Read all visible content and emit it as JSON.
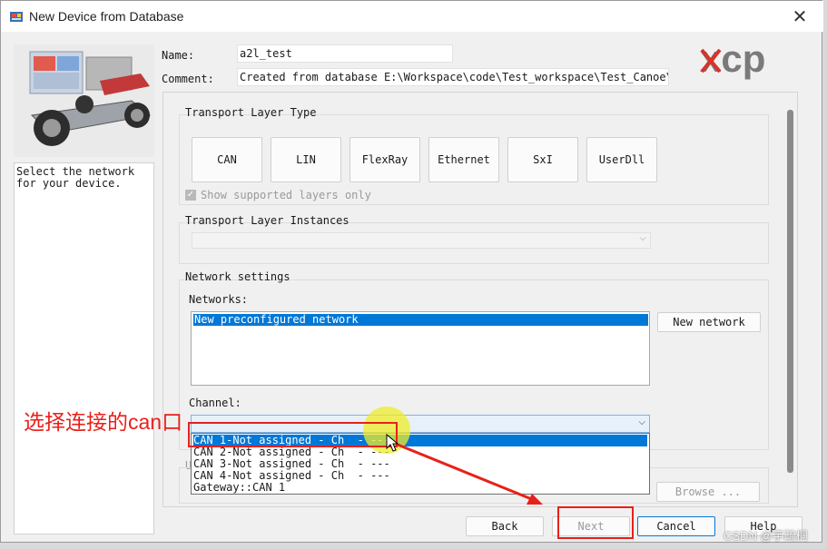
{
  "window": {
    "title": "New Device from Database"
  },
  "side_panel": {
    "hint": "Select the network\nfor your device."
  },
  "form": {
    "name_label": "Name:",
    "name_value": "a2l_test",
    "comment_label": "Comment:",
    "comment_value": "Created from database E:\\Workspace\\code\\Test_workspace\\Test_Canoe\\P"
  },
  "logo": {
    "text": "xcp"
  },
  "transport_type": {
    "heading": "Transport Layer Type",
    "buttons": [
      "CAN",
      "LIN",
      "FlexRay",
      "Ethernet",
      "SxI",
      "UserDll"
    ],
    "checkbox_label": "Show supported layers only",
    "checkbox_checked": true
  },
  "transport_instances": {
    "heading": "Transport Layer Instances"
  },
  "network_settings": {
    "heading": "Network settings",
    "networks_label": "Networks:",
    "networks": [
      "New preconfigured network"
    ],
    "new_network_button": "New network",
    "channel_label": "Channel:",
    "channel_options": [
      "CAN 1-Not assigned - Ch  - ---",
      "CAN 2-Not assigned - Ch  - ---",
      "CAN 3-Not assigned - Ch  - ---",
      "CAN 4-Not assigned - Ch  - ---",
      "Gateway::CAN 1"
    ],
    "browse_button": "Browse ..."
  },
  "partial_label": "U",
  "annotation": {
    "text": "选择连接的can口"
  },
  "footer": {
    "back": "Back",
    "next": "Next",
    "cancel": "Cancel",
    "help": "Help"
  },
  "watermark": "CSDN @宇疏桐",
  "colors": {
    "selection": "#0078d7",
    "annotation_red": "#e8201a",
    "highlight_yellow": "#f3ef3a"
  }
}
